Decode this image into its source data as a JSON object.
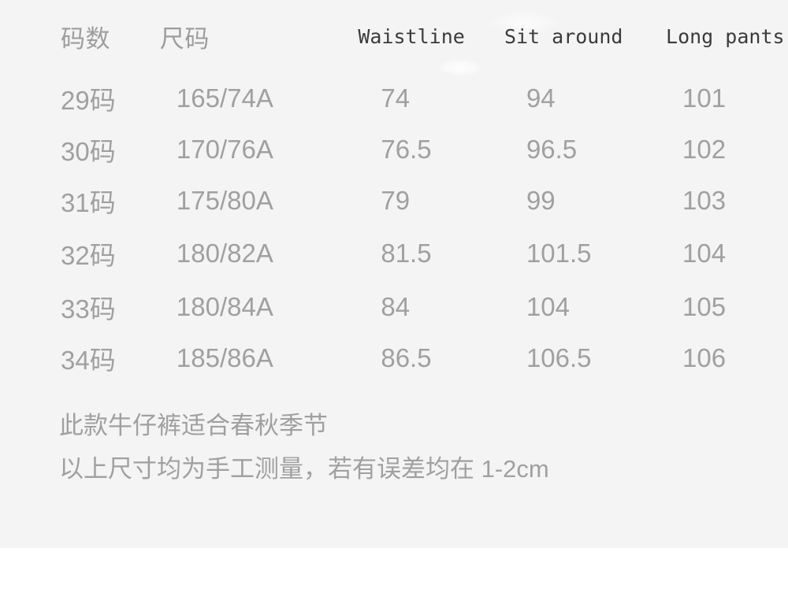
{
  "panel": {
    "background_color": "#f4f4f4",
    "page_background_color": "#ffffff",
    "text_color": "#a0a0a0",
    "header_cn_color": "#9d9d9d",
    "header_en_color": "#3b3b3b"
  },
  "size_table": {
    "headers": [
      {
        "label": "码数",
        "lang": "cn"
      },
      {
        "label": "尺码",
        "lang": "cn"
      },
      {
        "label": "Waistline",
        "lang": "en"
      },
      {
        "label": "Sit around",
        "lang": "en"
      },
      {
        "label": "Long pants",
        "lang": "en"
      }
    ],
    "rows": [
      {
        "size": "29码",
        "spec": "165/74A",
        "waistline": "74",
        "sit_around": "94",
        "long_pants": "101"
      },
      {
        "size": "30码",
        "spec": "170/76A",
        "waistline": "76.5",
        "sit_around": "96.5",
        "long_pants": "102"
      },
      {
        "size": "31码",
        "spec": "175/80A",
        "waistline": "79",
        "sit_around": "99",
        "long_pants": "103"
      },
      {
        "size": "32码",
        "spec": "180/82A",
        "waistline": "81.5",
        "sit_around": "101.5",
        "long_pants": "104"
      },
      {
        "size": "33码",
        "spec": "180/84A",
        "waistline": "84",
        "sit_around": "104",
        "long_pants": "105"
      },
      {
        "size": "34码",
        "spec": "185/86A",
        "waistline": "86.5",
        "sit_around": "106.5",
        "long_pants": "106"
      }
    ]
  },
  "notes": [
    "此款牛仔裤适合春秋季节",
    "以上尺寸均为手工测量，若有误差均在 1-2cm"
  ]
}
